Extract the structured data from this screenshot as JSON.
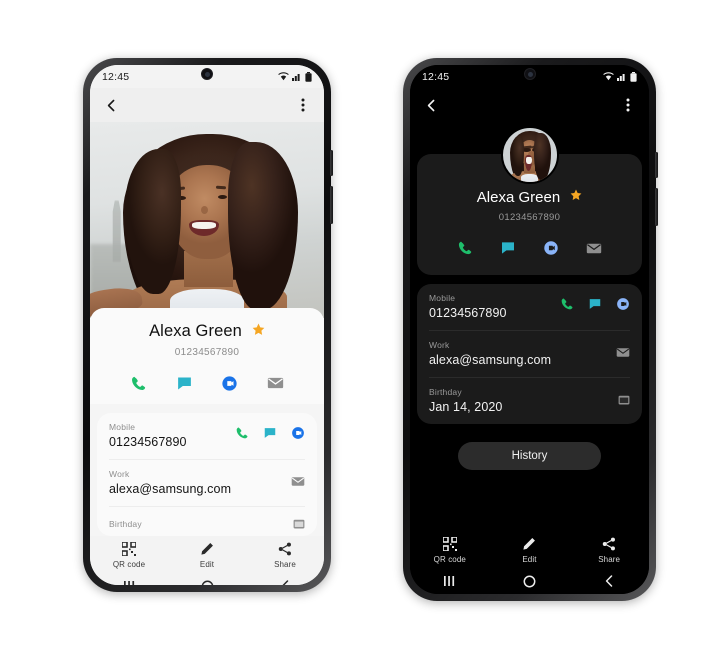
{
  "colors": {
    "accent_star": "#f5a623",
    "call_green": "#1ebe6b",
    "message_teal": "#2bb3c9",
    "duo_blue": "#1a73e8",
    "duo_blue_dark": "#8ab4f8",
    "mail_gray": "#8f8f8f",
    "light_bg": "#f5f5f5",
    "dark_bg": "#000000",
    "dark_card": "#1b1b1b"
  },
  "light_phone": {
    "status_bar": {
      "time": "12:45",
      "icons": [
        "wifi-icon",
        "signal-icon",
        "battery-icon"
      ]
    },
    "app_bar": {
      "back": "back-arrow-icon",
      "more": "more-options-icon"
    },
    "contact": {
      "name": "Alexa Green",
      "number": "01234567890",
      "favorite_icon": "star-icon",
      "actions": [
        {
          "name": "call-action",
          "icon": "phone-icon"
        },
        {
          "name": "message-action",
          "icon": "message-icon"
        },
        {
          "name": "video-action",
          "icon": "duo-video-icon"
        },
        {
          "name": "email-action",
          "icon": "mail-icon"
        }
      ]
    },
    "details": [
      {
        "label": "Mobile",
        "value": "01234567890",
        "icons": [
          "phone-icon",
          "message-icon",
          "duo-video-icon"
        ]
      },
      {
        "label": "Work",
        "value": "alexa@samsung.com",
        "icons": [
          "mail-icon"
        ]
      },
      {
        "label": "Birthday",
        "value": "",
        "icons": [
          "calendar-icon"
        ]
      }
    ],
    "bottom_bar": [
      {
        "label": "QR code",
        "icon": "qr-code-icon"
      },
      {
        "label": "Edit",
        "icon": "pencil-icon"
      },
      {
        "label": "Share",
        "icon": "share-icon"
      }
    ],
    "nav_bar": [
      {
        "name": "recents-button",
        "icon": "recents-icon"
      },
      {
        "name": "home-button",
        "icon": "home-circle-icon"
      },
      {
        "name": "back-button",
        "icon": "back-chevron-icon"
      }
    ]
  },
  "dark_phone": {
    "status_bar": {
      "time": "12:45",
      "icons": [
        "wifi-icon",
        "signal-icon",
        "battery-icon"
      ]
    },
    "app_bar": {
      "back": "back-arrow-icon",
      "more": "more-options-icon"
    },
    "contact": {
      "name": "Alexa Green",
      "number": "01234567890",
      "favorite_icon": "star-icon",
      "avatar": "contact-avatar",
      "actions": [
        {
          "name": "call-action",
          "icon": "phone-icon"
        },
        {
          "name": "message-action",
          "icon": "message-icon"
        },
        {
          "name": "video-action",
          "icon": "duo-video-icon"
        },
        {
          "name": "email-action",
          "icon": "mail-icon"
        }
      ]
    },
    "details": [
      {
        "label": "Mobile",
        "value": "01234567890",
        "icons": [
          "phone-icon",
          "message-icon",
          "duo-video-icon"
        ]
      },
      {
        "label": "Work",
        "value": "alexa@samsung.com",
        "icons": [
          "mail-icon"
        ]
      },
      {
        "label": "Birthday",
        "value": "Jan 14, 2020",
        "icons": [
          "calendar-icon"
        ]
      }
    ],
    "history_button": "History",
    "bottom_bar": [
      {
        "label": "QR code",
        "icon": "qr-code-icon"
      },
      {
        "label": "Edit",
        "icon": "pencil-icon"
      },
      {
        "label": "Share",
        "icon": "share-icon"
      }
    ],
    "nav_bar": [
      {
        "name": "recents-button",
        "icon": "recents-icon"
      },
      {
        "name": "home-button",
        "icon": "home-circle-icon"
      },
      {
        "name": "back-button",
        "icon": "back-chevron-icon"
      }
    ]
  }
}
